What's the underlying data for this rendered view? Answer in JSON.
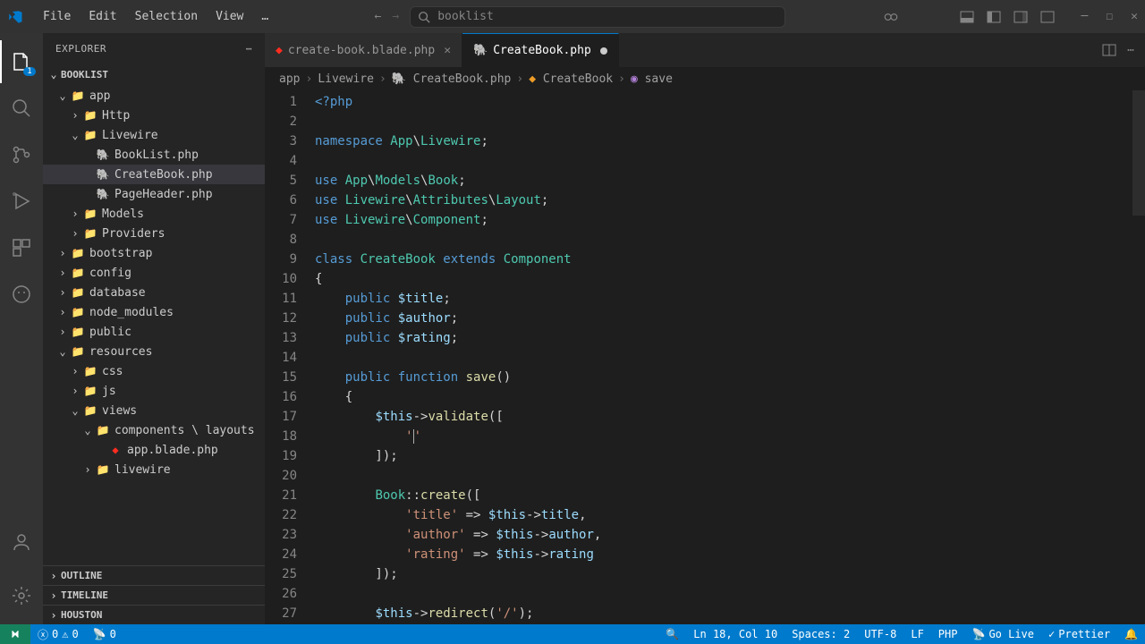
{
  "titlebar": {
    "menus": [
      "File",
      "Edit",
      "Selection",
      "View",
      "…"
    ],
    "search_placeholder": "booklist"
  },
  "activitybar": {
    "source_control_badge": "1"
  },
  "sidebar": {
    "header": "EXPLORER",
    "folder_name": "BOOKLIST",
    "tree": [
      {
        "name": "app",
        "type": "folder-open",
        "depth": 0,
        "icon": "folder-red"
      },
      {
        "name": "Http",
        "type": "folder",
        "depth": 1,
        "icon": "folder-teal"
      },
      {
        "name": "Livewire",
        "type": "folder-open",
        "depth": 1,
        "icon": "folder-teal"
      },
      {
        "name": "BookList.php",
        "type": "file",
        "depth": 2,
        "icon": "php"
      },
      {
        "name": "CreateBook.php",
        "type": "file",
        "depth": 2,
        "icon": "php",
        "selected": true
      },
      {
        "name": "PageHeader.php",
        "type": "file",
        "depth": 2,
        "icon": "php"
      },
      {
        "name": "Models",
        "type": "folder",
        "depth": 1,
        "icon": "folder-teal"
      },
      {
        "name": "Providers",
        "type": "folder",
        "depth": 1,
        "icon": "folder-teal"
      },
      {
        "name": "bootstrap",
        "type": "folder",
        "depth": 0,
        "icon": "folder"
      },
      {
        "name": "config",
        "type": "folder",
        "depth": 0,
        "icon": "folder-teal"
      },
      {
        "name": "database",
        "type": "folder",
        "depth": 0,
        "icon": "folder"
      },
      {
        "name": "node_modules",
        "type": "folder",
        "depth": 0,
        "icon": "folder-green"
      },
      {
        "name": "public",
        "type": "folder",
        "depth": 0,
        "icon": "folder-teal"
      },
      {
        "name": "resources",
        "type": "folder-open",
        "depth": 0,
        "icon": "folder-teal"
      },
      {
        "name": "css",
        "type": "folder",
        "depth": 1,
        "icon": "folder-blue"
      },
      {
        "name": "js",
        "type": "folder",
        "depth": 1,
        "icon": "folder"
      },
      {
        "name": "views",
        "type": "folder-open",
        "depth": 1,
        "icon": "folder-teal"
      },
      {
        "name": "components \\ layouts",
        "type": "folder-open",
        "depth": 2,
        "icon": "folder-teal"
      },
      {
        "name": "app.blade.php",
        "type": "file",
        "depth": 3,
        "icon": "laravel"
      },
      {
        "name": "livewire",
        "type": "folder",
        "depth": 2,
        "icon": "folder-teal"
      }
    ],
    "sections": [
      "OUTLINE",
      "TIMELINE",
      "HOUSTON"
    ]
  },
  "tabs": [
    {
      "label": "create-book.blade.php",
      "icon": "laravel",
      "active": false,
      "modified": false
    },
    {
      "label": "CreateBook.php",
      "icon": "php",
      "active": true,
      "modified": true
    }
  ],
  "breadcrumbs": [
    {
      "label": "app",
      "icon": ""
    },
    {
      "label": "Livewire",
      "icon": ""
    },
    {
      "label": "CreateBook.php",
      "icon": "php"
    },
    {
      "label": "CreateBook",
      "icon": "class"
    },
    {
      "label": "save",
      "icon": "method"
    }
  ],
  "code": {
    "start_line": 1,
    "lines": [
      [
        {
          "t": "<?php",
          "c": "kw"
        }
      ],
      [],
      [
        {
          "t": "namespace ",
          "c": "kw"
        },
        {
          "t": "App",
          "c": "ns"
        },
        {
          "t": "\\",
          "c": "punc"
        },
        {
          "t": "Livewire",
          "c": "ns"
        },
        {
          "t": ";",
          "c": "punc"
        }
      ],
      [],
      [
        {
          "t": "use ",
          "c": "kw"
        },
        {
          "t": "App",
          "c": "ns"
        },
        {
          "t": "\\",
          "c": "punc"
        },
        {
          "t": "Models",
          "c": "ns"
        },
        {
          "t": "\\",
          "c": "punc"
        },
        {
          "t": "Book",
          "c": "ns"
        },
        {
          "t": ";",
          "c": "punc"
        }
      ],
      [
        {
          "t": "use ",
          "c": "kw"
        },
        {
          "t": "Livewire",
          "c": "ns"
        },
        {
          "t": "\\",
          "c": "punc"
        },
        {
          "t": "Attributes",
          "c": "ns"
        },
        {
          "t": "\\",
          "c": "punc"
        },
        {
          "t": "Layout",
          "c": "ns"
        },
        {
          "t": ";",
          "c": "punc"
        }
      ],
      [
        {
          "t": "use ",
          "c": "kw"
        },
        {
          "t": "Livewire",
          "c": "ns"
        },
        {
          "t": "\\",
          "c": "punc"
        },
        {
          "t": "Component",
          "c": "ns"
        },
        {
          "t": ";",
          "c": "punc"
        }
      ],
      [],
      [
        {
          "t": "class ",
          "c": "kw"
        },
        {
          "t": "CreateBook",
          "c": "type"
        },
        {
          "t": " extends ",
          "c": "kw"
        },
        {
          "t": "Component",
          "c": "type"
        }
      ],
      [
        {
          "t": "{",
          "c": "punc"
        }
      ],
      [
        {
          "t": "    ",
          "c": ""
        },
        {
          "t": "public ",
          "c": "modifier"
        },
        {
          "t": "$title",
          "c": "var"
        },
        {
          "t": ";",
          "c": "punc"
        }
      ],
      [
        {
          "t": "    ",
          "c": ""
        },
        {
          "t": "public ",
          "c": "modifier"
        },
        {
          "t": "$author",
          "c": "var"
        },
        {
          "t": ";",
          "c": "punc"
        }
      ],
      [
        {
          "t": "    ",
          "c": ""
        },
        {
          "t": "public ",
          "c": "modifier"
        },
        {
          "t": "$rating",
          "c": "var"
        },
        {
          "t": ";",
          "c": "punc"
        }
      ],
      [],
      [
        {
          "t": "    ",
          "c": ""
        },
        {
          "t": "public ",
          "c": "modifier"
        },
        {
          "t": "function ",
          "c": "kw"
        },
        {
          "t": "save",
          "c": "fn"
        },
        {
          "t": "()",
          "c": "punc"
        }
      ],
      [
        {
          "t": "    {",
          "c": "punc"
        }
      ],
      [
        {
          "t": "        ",
          "c": ""
        },
        {
          "t": "$this",
          "c": "var"
        },
        {
          "t": "->",
          "c": "punc"
        },
        {
          "t": "validate",
          "c": "fn"
        },
        {
          "t": "([",
          "c": "punc"
        }
      ],
      [
        {
          "t": "            ",
          "c": ""
        },
        {
          "t": "'",
          "c": "str"
        },
        {
          "t": "",
          "c": "",
          "cursor": true
        },
        {
          "t": "'",
          "c": "str"
        }
      ],
      [
        {
          "t": "        ]);",
          "c": "punc"
        }
      ],
      [],
      [
        {
          "t": "        ",
          "c": ""
        },
        {
          "t": "Book",
          "c": "type"
        },
        {
          "t": "::",
          "c": "punc"
        },
        {
          "t": "create",
          "c": "fn"
        },
        {
          "t": "([",
          "c": "punc"
        }
      ],
      [
        {
          "t": "            ",
          "c": ""
        },
        {
          "t": "'title'",
          "c": "str"
        },
        {
          "t": " => ",
          "c": "punc"
        },
        {
          "t": "$this",
          "c": "var"
        },
        {
          "t": "->",
          "c": "punc"
        },
        {
          "t": "title",
          "c": "var"
        },
        {
          "t": ",",
          "c": "punc"
        }
      ],
      [
        {
          "t": "            ",
          "c": ""
        },
        {
          "t": "'author'",
          "c": "str"
        },
        {
          "t": " => ",
          "c": "punc"
        },
        {
          "t": "$this",
          "c": "var"
        },
        {
          "t": "->",
          "c": "punc"
        },
        {
          "t": "author",
          "c": "var"
        },
        {
          "t": ",",
          "c": "punc"
        }
      ],
      [
        {
          "t": "            ",
          "c": ""
        },
        {
          "t": "'rating'",
          "c": "str"
        },
        {
          "t": " => ",
          "c": "punc"
        },
        {
          "t": "$this",
          "c": "var"
        },
        {
          "t": "->",
          "c": "punc"
        },
        {
          "t": "rating",
          "c": "var"
        }
      ],
      [
        {
          "t": "        ]);",
          "c": "punc"
        }
      ],
      [],
      [
        {
          "t": "        ",
          "c": ""
        },
        {
          "t": "$this",
          "c": "var"
        },
        {
          "t": "->",
          "c": "punc"
        },
        {
          "t": "redirect",
          "c": "fn"
        },
        {
          "t": "(",
          "c": "punc"
        },
        {
          "t": "'/'",
          "c": "str"
        },
        {
          "t": ");",
          "c": "punc"
        }
      ]
    ]
  },
  "statusbar": {
    "errors": "0",
    "warnings": "0",
    "ports": "0",
    "cursor": "Ln 18, Col 10",
    "spaces": "Spaces: 2",
    "encoding": "UTF-8",
    "eol": "LF",
    "language": "PHP",
    "golive": "Go Live",
    "prettier": "Prettier"
  }
}
